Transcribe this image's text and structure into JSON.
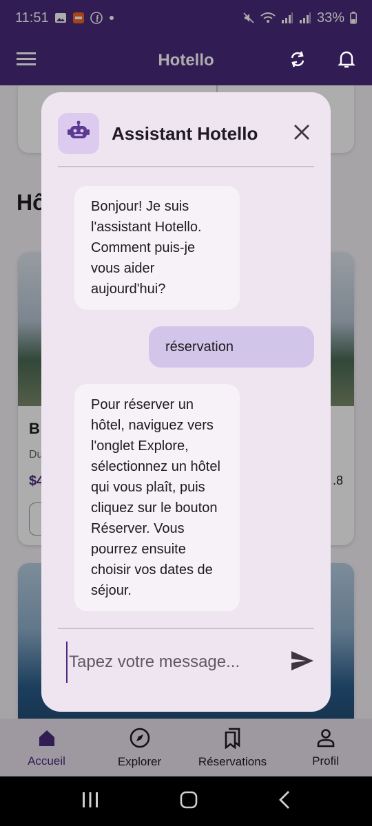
{
  "status_bar": {
    "time": "11:51",
    "battery": "33%"
  },
  "app_bar": {
    "title": "Hotello"
  },
  "background": {
    "section_heading": "Hô",
    "card_name_partial": "B",
    "card_sub_partial": "Du",
    "card_price_partial": "$4",
    "card_rating_partial": ".8"
  },
  "dialog": {
    "title": "Assistant Hotello",
    "messages": [
      {
        "sender": "bot",
        "text": "Bonjour! Je suis l'assistant Hotello. Comment puis-je vous aider aujourd'hui?"
      },
      {
        "sender": "user",
        "text": "réservation"
      },
      {
        "sender": "bot",
        "text": "Pour réserver un hôtel, naviguez vers l'onglet Explore, sélectionnez un hôtel qui vous plaît, puis cliquez sur le bouton Réserver. Vous pourrez ensuite choisir vos dates de séjour."
      }
    ],
    "input": {
      "placeholder": "Tapez votre message...",
      "value": ""
    }
  },
  "bottom_nav": {
    "items": [
      {
        "label": "Accueil",
        "icon": "home-icon",
        "active": true
      },
      {
        "label": "Explorer",
        "icon": "compass-icon",
        "active": false
      },
      {
        "label": "Réservations",
        "icon": "bookmarks-icon",
        "active": false
      },
      {
        "label": "Profil",
        "icon": "person-icon",
        "active": false
      }
    ]
  },
  "colors": {
    "primary": "#4b2a7c",
    "dialog_bg": "#efe5f1",
    "user_bubble": "#d2c5ea",
    "bot_bubble": "#f6f2f7"
  }
}
